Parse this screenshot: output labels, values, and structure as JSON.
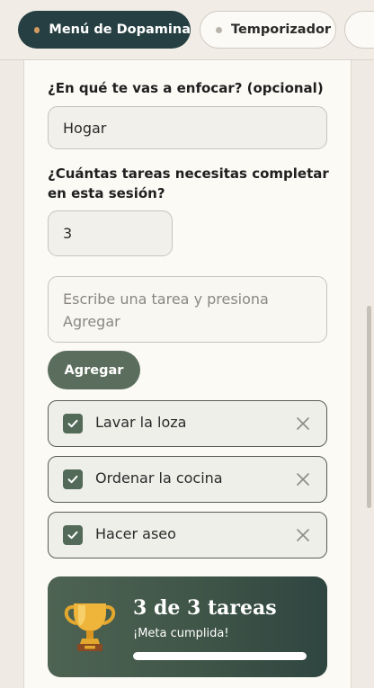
{
  "tabs": [
    {
      "label": "Menú de Dopamina",
      "active": true
    },
    {
      "label": "Temporizador",
      "active": false
    }
  ],
  "form": {
    "focus_label": "¿En qué te vas a enfocar? (opcional)",
    "focus_value": "Hogar",
    "count_label_line1": "¿Cuántas tareas necesitas completar",
    "count_label_line2": "en esta sesión?",
    "count_value": "3",
    "task_placeholder_line1": "Escribe una tarea y presiona",
    "task_placeholder_line2": "Agregar",
    "add_button": "Agregar"
  },
  "tasks": [
    {
      "label": "Lavar la loza",
      "done": true
    },
    {
      "label": "Ordenar la cocina",
      "done": true
    },
    {
      "label": "Hacer aseo",
      "done": true
    }
  ],
  "progress": {
    "title": "3 de 3 tareas",
    "subtitle": "¡Meta cumplida!",
    "completed": 3,
    "total": 3
  },
  "colors": {
    "active_tab": "#263f42",
    "accent_dot": "#d39a62",
    "primary_button": "#5b6d5c",
    "checkbox": "#536a58",
    "trophy": "#e3a72e"
  },
  "icons": {
    "check": "check-icon",
    "remove": "close-icon",
    "trophy": "trophy-icon"
  }
}
